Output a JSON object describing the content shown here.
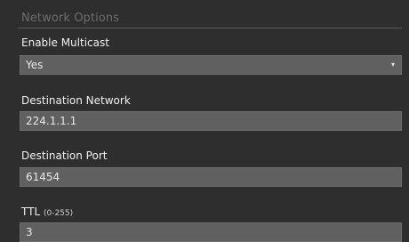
{
  "section": {
    "title": "Network Options"
  },
  "multicast": {
    "label": "Enable Multicast",
    "selected": "Yes",
    "arrow_glyph": "▾"
  },
  "destination_network": {
    "label": "Destination Network",
    "value": "224.1.1.1"
  },
  "destination_port": {
    "label": "Destination Port",
    "value": "61454"
  },
  "ttl": {
    "label": "TTL",
    "hint": "(0-255)",
    "value": "3"
  }
}
